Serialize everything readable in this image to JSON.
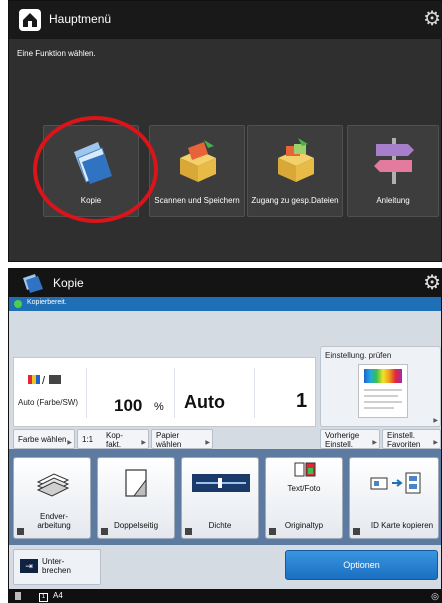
{
  "main_menu": {
    "title": "Hauptmenü",
    "subtitle": "Eine Funktion wählen.",
    "tiles": [
      {
        "label": "Kopie"
      },
      {
        "label": "Scannen und Speichern"
      },
      {
        "label": "Zugang zu gesp.Dateien"
      },
      {
        "label": "Anleitung"
      }
    ]
  },
  "copy": {
    "title": "Kopie",
    "status": "Kopierbereit.",
    "color_mode_label": "Auto (Farbe/SW)",
    "ratio_value": "100",
    "ratio_unit": "%",
    "paper_value": "Auto",
    "copies": "1",
    "check_label": "Einstellung. prüfen",
    "row_buttons": {
      "color": "Farbe wählen",
      "ratio_prefix": "1:1",
      "ratio": "Kop-fakt.",
      "paper": "Papier wählen",
      "previous": "Vorherige Einstell.",
      "favorites": "Einstell. Favoriten"
    },
    "functions": [
      {
        "label": "Endver-arbeitung"
      },
      {
        "label": "Doppelseitig"
      },
      {
        "label": "Dichte"
      },
      {
        "label": "Originaltyp",
        "extra": "Text/Foto"
      },
      {
        "label": "ID Karte kopieren"
      }
    ],
    "interrupt": "Unter-brechen",
    "options": "Optionen",
    "footer_tray": "A4"
  },
  "colors": {
    "status_blue": "#1e6fb6",
    "options_blue": "#1a6fc0",
    "highlight_red": "#d9141b",
    "function_bar": "#5d7aa0"
  }
}
